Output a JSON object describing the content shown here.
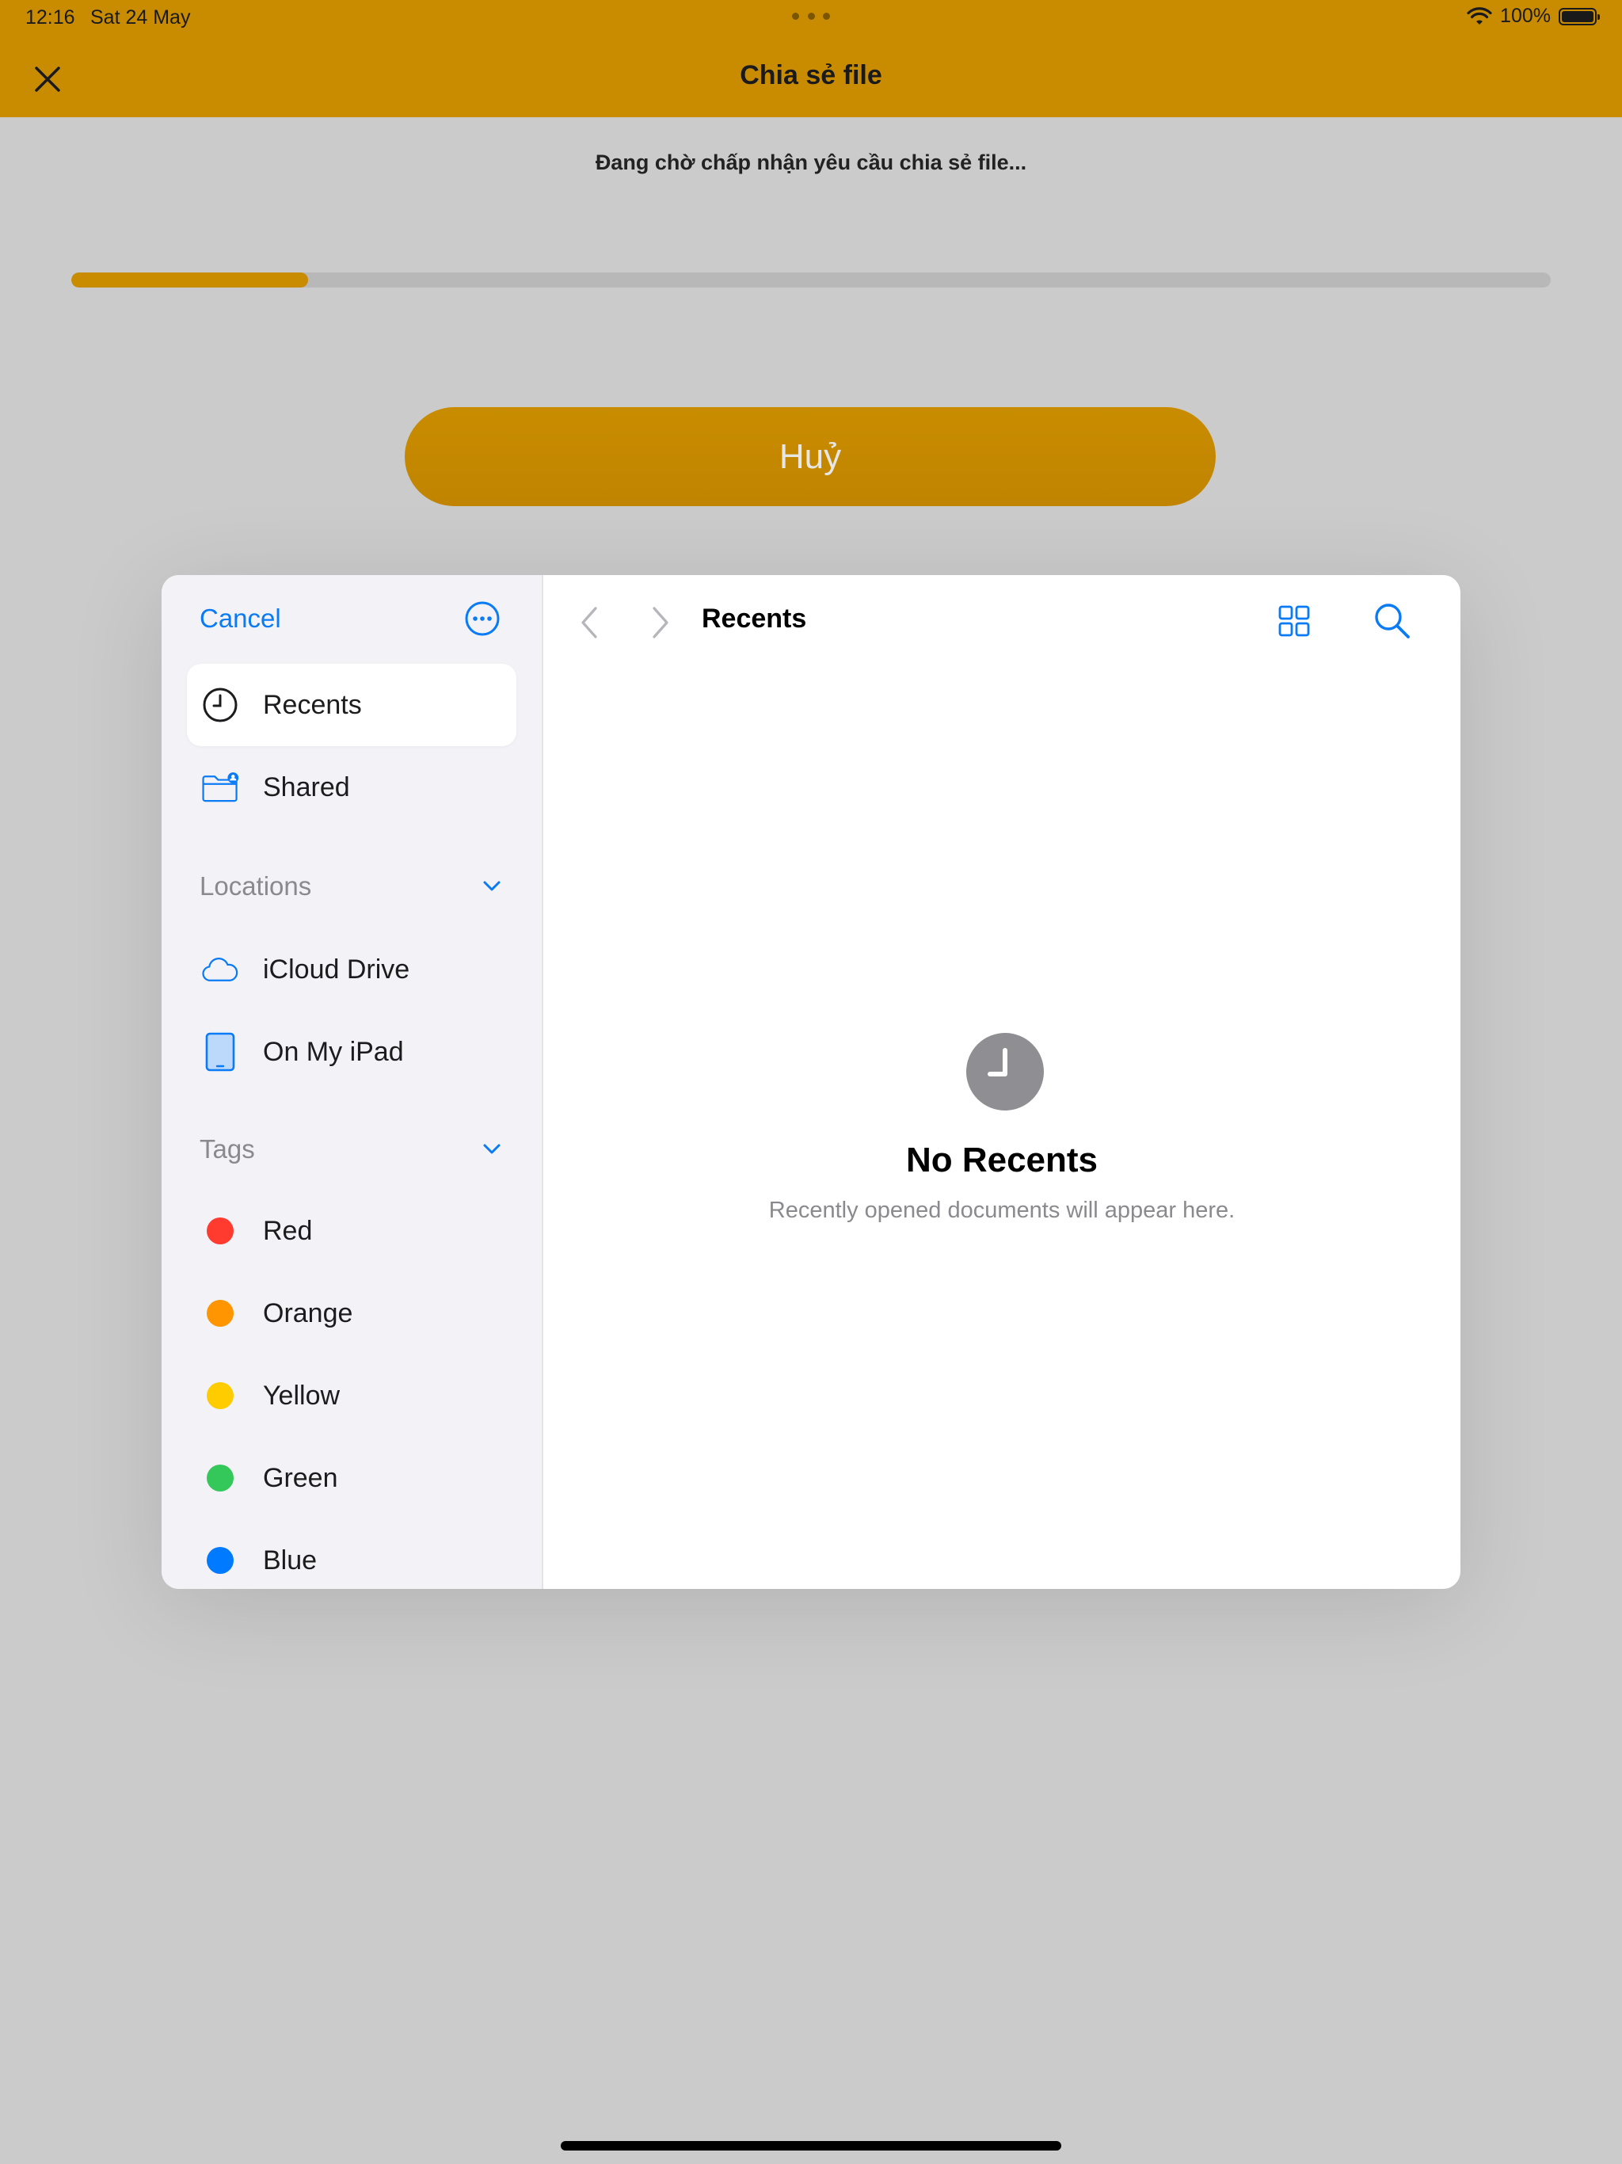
{
  "status_bar": {
    "time": "12:16",
    "date": "Sat 24 May",
    "battery": "100%"
  },
  "nav": {
    "title": "Chia sẻ file"
  },
  "transfer": {
    "message": "Đang chờ chấp nhận yêu cầu chia sẻ file...",
    "progress_fraction": 0.16,
    "cancel_label": "Huỷ"
  },
  "colors": {
    "accent": "#c98c00",
    "ios_blue": "#0a7bf5",
    "overlay_bg": "#cbcbcb"
  },
  "picker": {
    "cancel_label": "Cancel",
    "sidebar": {
      "favorites": [
        {
          "label": "Recents",
          "icon": "clock-icon",
          "selected": true
        },
        {
          "label": "Shared",
          "icon": "shared-folder-icon",
          "selected": false
        }
      ],
      "locations_header": "Locations",
      "locations": [
        {
          "label": "iCloud Drive",
          "icon": "cloud-icon"
        },
        {
          "label": "On My iPad",
          "icon": "ipad-icon"
        }
      ],
      "tags_header": "Tags",
      "tags": [
        {
          "label": "Red",
          "color": "#ff3b30"
        },
        {
          "label": "Orange",
          "color": "#ff9500"
        },
        {
          "label": "Yellow",
          "color": "#ffcc00"
        },
        {
          "label": "Green",
          "color": "#34c759"
        },
        {
          "label": "Blue",
          "color": "#007aff"
        }
      ]
    },
    "main": {
      "title": "Recents",
      "empty_title": "No Recents",
      "empty_subtitle": "Recently opened documents will appear here."
    }
  }
}
